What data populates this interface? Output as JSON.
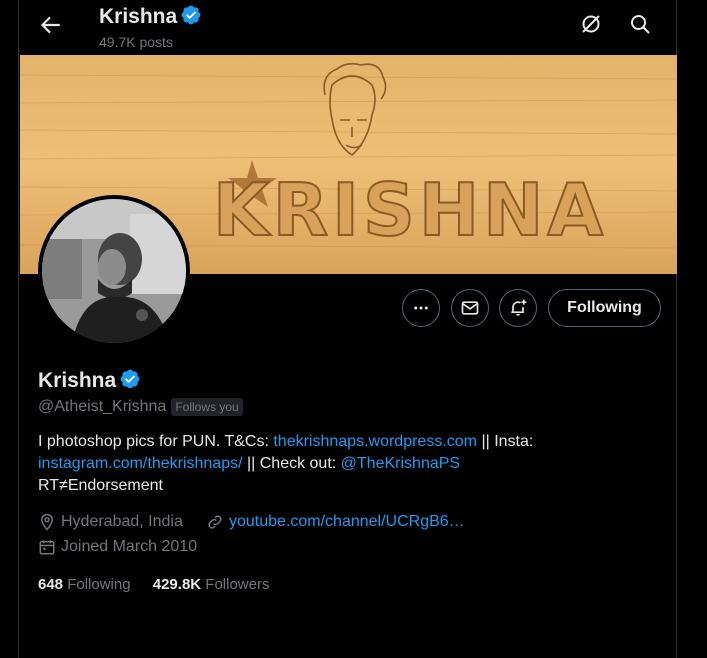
{
  "header": {
    "name": "Krishna",
    "posts": "49.7K posts"
  },
  "banner": {
    "text": "KRISHNA"
  },
  "actions": {
    "following_label": "Following"
  },
  "profile": {
    "name": "Krishna",
    "handle": "@Atheist_Krishna",
    "follows_you": "Follows you",
    "bio": {
      "part1": "I photoshop pics for PUN. T&Cs: ",
      "link1": "thekrishnaps.wordpress.com",
      "part2": " || Insta: ",
      "link2": "instagram.com/thekrishnaps/",
      "part3": " || Check out: ",
      "link3": "@TheKrishnaPS",
      "part4": "RT≠Endorsement"
    },
    "location": "Hyderabad, India",
    "website": "youtube.com/channel/UCRgB6…",
    "joined": "Joined March 2010",
    "following_count": "648",
    "following_label": "Following",
    "followers_count": "429.8K",
    "followers_label": "Followers"
  },
  "colors": {
    "accent": "#1d9bf0",
    "muted": "#71767b",
    "bg": "#000000"
  }
}
